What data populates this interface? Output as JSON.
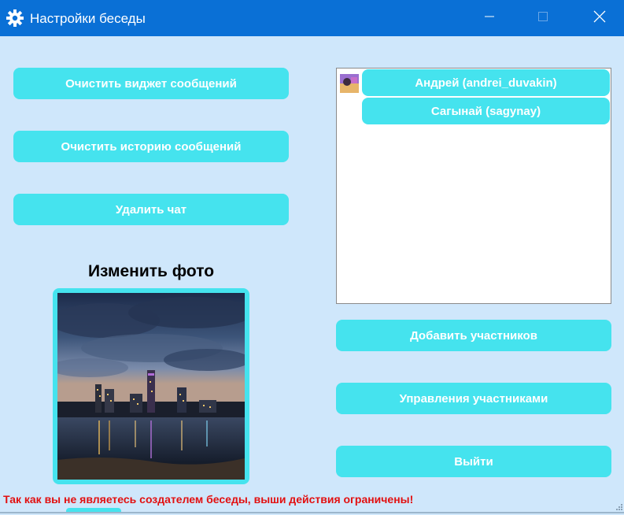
{
  "window": {
    "title": "Настройки беседы",
    "controls": {
      "minimize_icon": "minimize-icon",
      "maximize_icon": "maximize-icon",
      "close_icon": "close-icon"
    },
    "title_icon": "gear-icon"
  },
  "actions": {
    "clear_widget": "Очистить виджет сообщений",
    "clear_history": "Очистить историю сообщений",
    "delete_chat": "Удалить чат"
  },
  "photo": {
    "label": "Изменить фото",
    "image": "evening city skyline over river"
  },
  "participants": [
    {
      "name": "Андрей (andrei_duvakin)",
      "has_avatar": true
    },
    {
      "name": "Сагынай (sagynay)",
      "has_avatar": false
    }
  ],
  "participant_actions": {
    "add": "Добавить участников",
    "manage": "Управления участниками",
    "leave": "Выйти"
  },
  "warning": "Так как вы не являетесь создателем беседы, выши действия ограничены!",
  "colors": {
    "titlebar": "#0a70d6",
    "background": "#cfe7fb",
    "button": "#45e3ee",
    "warning": "#e21010"
  }
}
